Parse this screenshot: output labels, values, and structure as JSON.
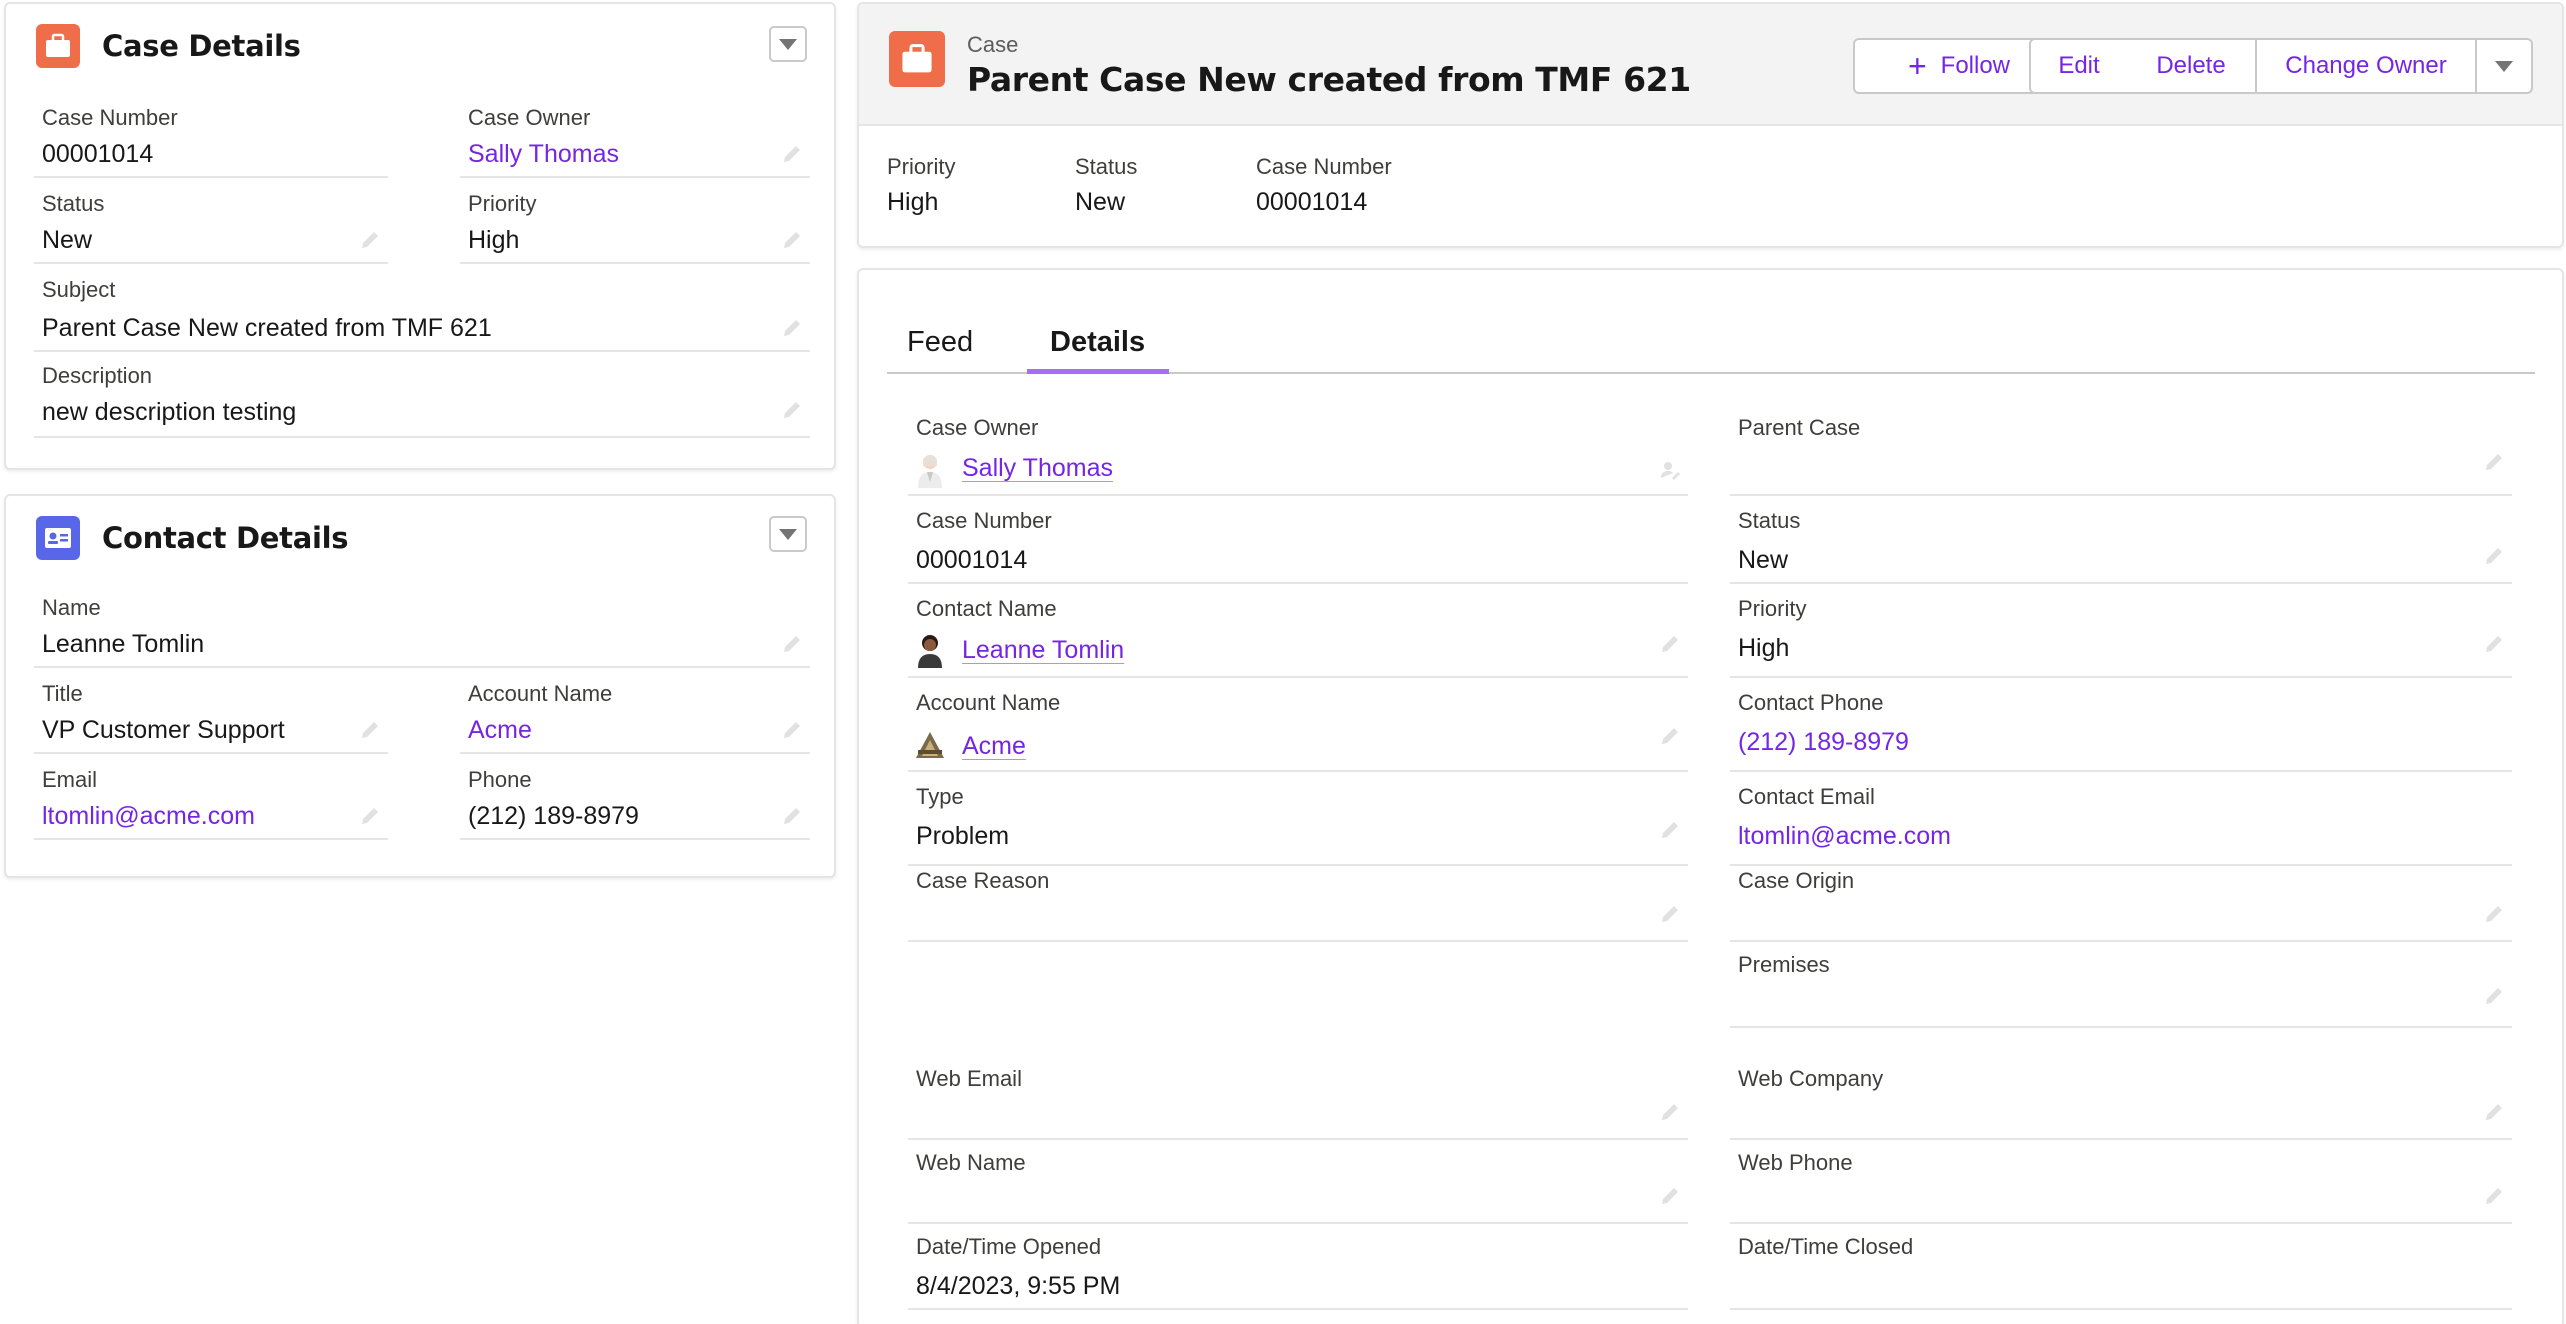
{
  "case_details": {
    "title": "Case Details",
    "fields": {
      "case_number_label": "Case Number",
      "case_number": "00001014",
      "case_owner_label": "Case Owner",
      "case_owner": "Sally Thomas",
      "status_label": "Status",
      "status": "New",
      "priority_label": "Priority",
      "priority": "High",
      "subject_label": "Subject",
      "subject": "Parent Case New created from TMF 621",
      "description_label": "Description",
      "description": "new description testing"
    }
  },
  "contact_details": {
    "title": "Contact Details",
    "fields": {
      "name_label": "Name",
      "name": "Leanne Tomlin",
      "title_label": "Title",
      "title": "VP Customer Support",
      "account_label": "Account Name",
      "account": "Acme",
      "email_label": "Email",
      "email": "ltomlin@acme.com",
      "phone_label": "Phone",
      "phone": "(212) 189-8979"
    }
  },
  "highlights": {
    "eyebrow": "Case",
    "title": "Parent Case New created from TMF 621",
    "buttons": {
      "follow": "Follow",
      "edit": "Edit",
      "delete": "Delete",
      "change_owner": "Change Owner"
    },
    "fields": {
      "priority_label": "Priority",
      "priority": "High",
      "status_label": "Status",
      "status": "New",
      "case_number_label": "Case Number",
      "case_number": "00001014"
    }
  },
  "tabs": {
    "feed": "Feed",
    "details": "Details",
    "active": "Details"
  },
  "details": {
    "case_owner_label": "Case Owner",
    "case_owner": "Sally Thomas",
    "parent_case_label": "Parent Case",
    "parent_case": "",
    "case_number_label": "Case Number",
    "case_number": "00001014",
    "status_label": "Status",
    "status": "New",
    "contact_name_label": "Contact Name",
    "contact_name": "Leanne Tomlin",
    "priority_label": "Priority",
    "priority": "High",
    "account_name_label": "Account Name",
    "account_name": "Acme",
    "contact_phone_label": "Contact Phone",
    "contact_phone": "(212) 189-8979",
    "type_label": "Type",
    "type": "Problem",
    "contact_email_label": "Contact Email",
    "contact_email": "ltomlin@acme.com",
    "case_reason_label": "Case Reason",
    "case_reason": "",
    "case_origin_label": "Case Origin",
    "case_origin": "",
    "premises_label": "Premises",
    "premises": "",
    "web_email_label": "Web Email",
    "web_email": "",
    "web_company_label": "Web Company",
    "web_company": "",
    "web_name_label": "Web Name",
    "web_name": "",
    "web_phone_label": "Web Phone",
    "web_phone": "",
    "opened_label": "Date/Time Opened",
    "opened": "8/4/2023, 9:55 PM",
    "closed_label": "Date/Time Closed",
    "closed": ""
  },
  "colors": {
    "link": "#7526e3",
    "case_icon": "#f06d4a",
    "contact_icon": "#5867e8",
    "tab_accent": "#a570f0"
  },
  "icons": [
    "briefcase-icon",
    "contact-card-icon",
    "chevron-down-icon",
    "pencil-icon",
    "plus-icon",
    "avatar-icon",
    "account-logo-icon",
    "change-owner-icon"
  ]
}
